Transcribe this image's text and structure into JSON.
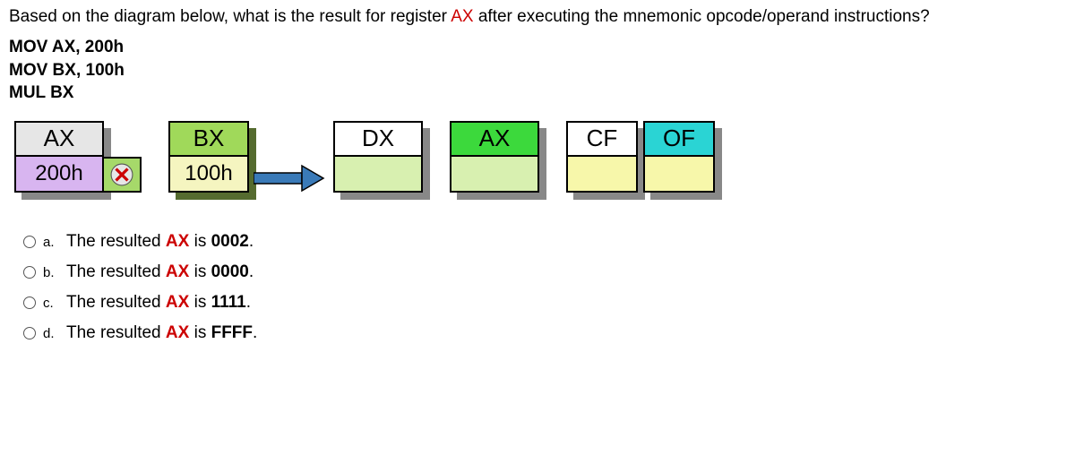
{
  "question": {
    "prefix": "Based on the diagram below, what is the result for register ",
    "reg": "AX",
    "suffix": "  after executing the mnemonic opcode/operand instructions?"
  },
  "code": {
    "line1": "MOV AX, 200h",
    "line2": "MOV BX, 100h",
    "line3": "MUL  BX"
  },
  "diagram": {
    "ax": {
      "label": "AX",
      "value": "200h"
    },
    "mult": "X",
    "bx": {
      "label": "BX",
      "value": "100h"
    },
    "dx": {
      "label": "DX",
      "value": ""
    },
    "ax2": {
      "label": "AX",
      "value": ""
    },
    "cf": {
      "label": "CF",
      "value": ""
    },
    "of": {
      "label": "OF",
      "value": ""
    }
  },
  "options": [
    {
      "letter": "a.",
      "prefix": "The resulted ",
      "reg": "AX",
      "mid": " is ",
      "val": "0002",
      "suffix": "."
    },
    {
      "letter": "b.",
      "prefix": "The resulted ",
      "reg": "AX",
      "mid": " is ",
      "val": "0000",
      "suffix": "."
    },
    {
      "letter": "c.",
      "prefix": "The resulted ",
      "reg": "AX",
      "mid": " is ",
      "val": "1111",
      "suffix": "."
    },
    {
      "letter": "d.",
      "prefix": "The resulted ",
      "reg": "AX",
      "mid": " is ",
      "val": "FFFF",
      "suffix": "."
    }
  ]
}
